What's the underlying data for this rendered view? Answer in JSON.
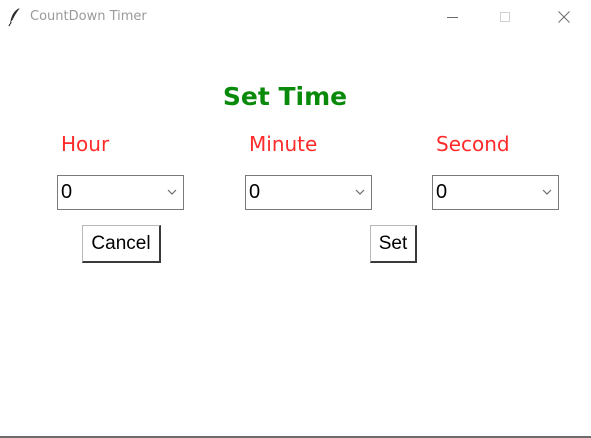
{
  "window": {
    "title": "CountDown Timer",
    "icon": "feather-icon",
    "controls": {
      "minimize_icon": "minimize-icon",
      "maximize_icon": "maximize-icon",
      "close_icon": "close-icon"
    }
  },
  "form": {
    "heading": "Set Time",
    "heading_color": "#0a8a0a",
    "label_color": "#ff2b2b",
    "fields": [
      {
        "label": "Hour",
        "value": "0"
      },
      {
        "label": "Minute",
        "value": "0"
      },
      {
        "label": "Second",
        "value": "0"
      }
    ],
    "buttons": {
      "cancel_label": "Cancel",
      "set_label": "Set"
    }
  }
}
